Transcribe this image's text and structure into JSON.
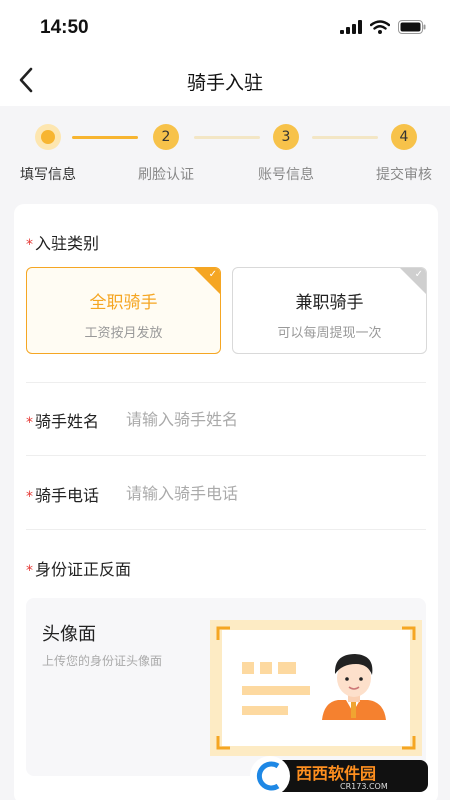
{
  "status": {
    "time": "14:50"
  },
  "nav": {
    "title": "骑手入驻"
  },
  "steps": [
    {
      "number": "1",
      "label": "填写信息",
      "active": true
    },
    {
      "number": "2",
      "label": "刷脸认证",
      "active": false
    },
    {
      "number": "3",
      "label": "账号信息",
      "active": false
    },
    {
      "number": "4",
      "label": "提交审核",
      "active": false
    }
  ],
  "form": {
    "required_mark": "*",
    "category": {
      "title": "入驻类别",
      "options": [
        {
          "name": "全职骑手",
          "desc": "工资按月发放",
          "selected": true
        },
        {
          "name": "兼职骑手",
          "desc": "可以每周提现一次",
          "selected": false
        }
      ]
    },
    "name_field": {
      "label": "骑手姓名",
      "placeholder": "请输入骑手姓名",
      "value": ""
    },
    "phone_field": {
      "label": "骑手电话",
      "placeholder": "请输入骑手电话",
      "value": ""
    },
    "id_card": {
      "title": "身份证正反面",
      "front_title": "头像面",
      "front_desc": "上传您的身份证头像面"
    }
  },
  "watermark": {
    "text": "西西软件园",
    "url": "CR173.COM"
  },
  "colors": {
    "accent": "#f5a623",
    "step_active": "#f7b531",
    "required": "#e53935"
  }
}
